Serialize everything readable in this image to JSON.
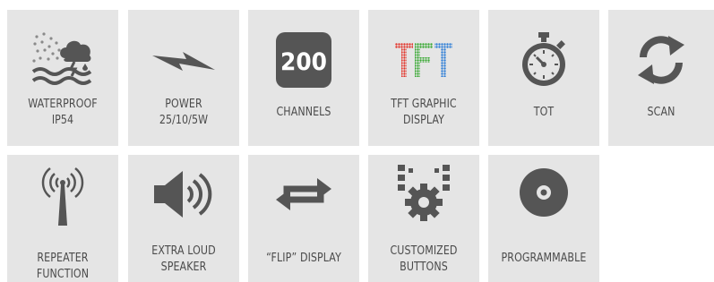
{
  "colors": {
    "tile_bg": "#e5e5e5",
    "icon": "#555555",
    "text": "#4b4b4b"
  },
  "features": [
    {
      "label_line1": "WATERPROOF",
      "label_line2": "IP54",
      "icon": "waterproof-icon"
    },
    {
      "label_line1": "POWER",
      "label_line2": "25/10/5W",
      "icon": "lightning-bolt-icon"
    },
    {
      "label_line1": "CHANNELS",
      "label_line2": "",
      "icon": "channels-200-icon",
      "icon_text": "200"
    },
    {
      "label_line1": "TFT GRAPHIC",
      "label_line2": "DISPLAY",
      "icon": "tft-display-icon",
      "icon_text": "TFT"
    },
    {
      "label_line1": "TOT",
      "label_line2": "",
      "icon": "stopwatch-icon"
    },
    {
      "label_line1": "SCAN",
      "label_line2": "",
      "icon": "scan-arrows-icon"
    },
    {
      "label_line1": "REPEATER FUNCTION",
      "label_line2": "",
      "icon": "antenna-icon"
    },
    {
      "label_line1": "EXTRA LOUD",
      "label_line2": "SPEAKER",
      "icon": "speaker-icon"
    },
    {
      "label_line1": "“FLIP” DISPLAY",
      "label_line2": "",
      "icon": "flip-arrows-icon"
    },
    {
      "label_line1": "CUSTOMIZED",
      "label_line2": "BUTTONS",
      "icon": "gear-buttons-icon"
    },
    {
      "label_line1": "PROGRAMMABLE",
      "label_line2": "",
      "icon": "disc-icon"
    }
  ]
}
